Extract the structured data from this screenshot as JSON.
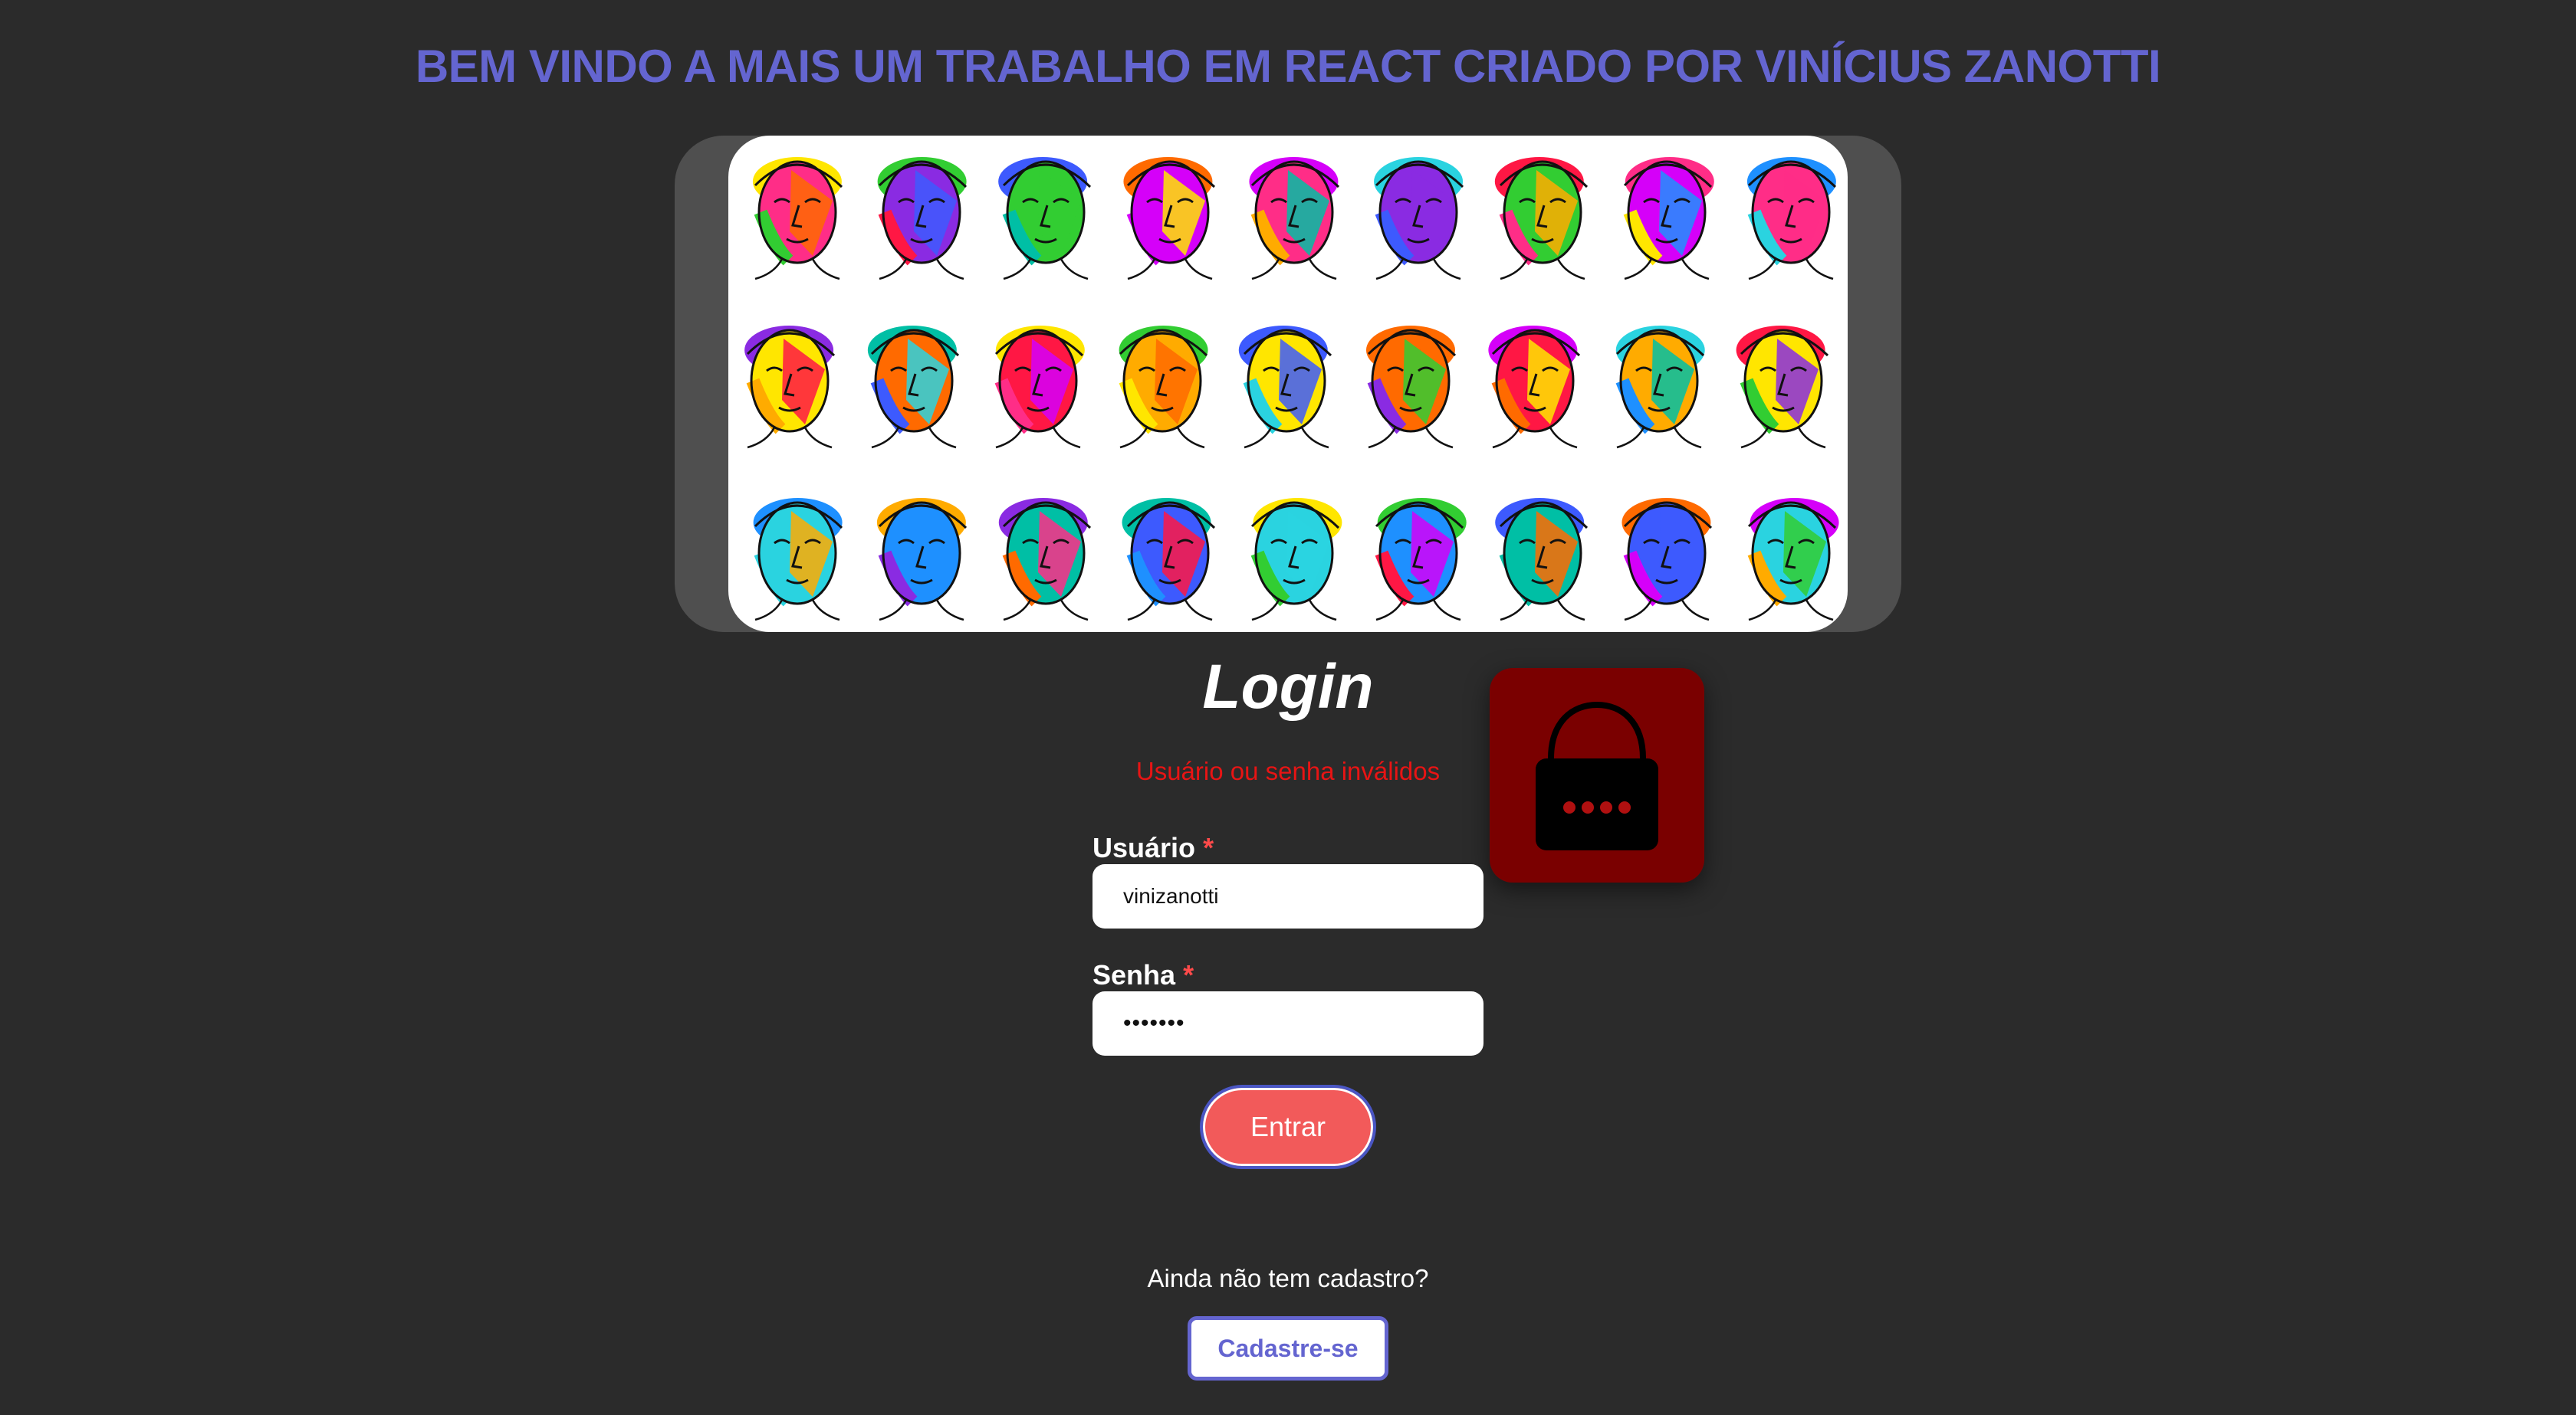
{
  "colors": {
    "background": "#2b2b2b",
    "title": "#6465d0",
    "error": "#e81414",
    "button_red": "#f25a5a",
    "lock_tile": "#7a0000",
    "lock_body": "#000000",
    "lock_dots": "#b01010",
    "signup_text": "#6465d0"
  },
  "header": {
    "title": "BEM VINDO A MAIS UM TRABALHO EM REACT CRIADO POR VINÍCIUS ZANOTTI"
  },
  "banner": {
    "image": "colorful-line-art-faces-illustration"
  },
  "login": {
    "title": "Login",
    "error": "Usuário ou senha inválidos",
    "username_label": "Usuário",
    "username_value": "vinizanotti",
    "password_label": "Senha",
    "password_value": "•••••••",
    "required_mark": "*",
    "submit_label": "Entrar",
    "lock_icon": "lock-icon"
  },
  "signup": {
    "prompt": "Ainda não tem cadastro?",
    "button_label": "Cadastre-se"
  }
}
